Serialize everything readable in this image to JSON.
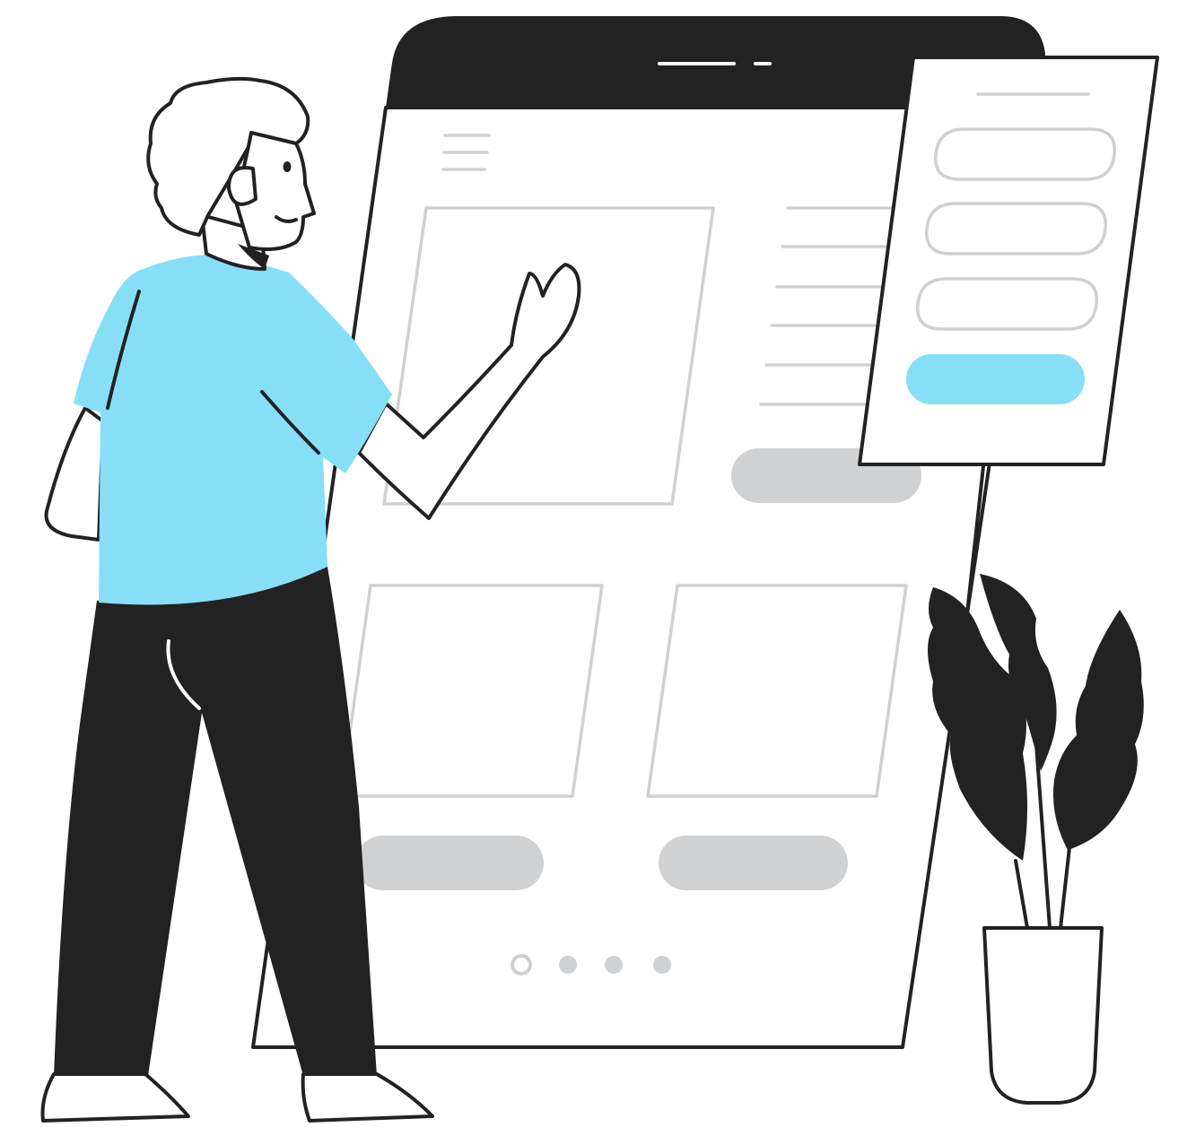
{
  "colors": {
    "ink": "#222222",
    "accent": "#87dff7",
    "placeholder": "#d0d1d3",
    "wireframe_line": "#d0d0d0",
    "paper": "#ffffff"
  },
  "illustration": {
    "subject": "person-pointing-at-tablet-wireframe",
    "icons": [
      "tablet-device",
      "login-form-panel",
      "potted-plant",
      "person"
    ]
  },
  "tablet": {
    "grid_cards": 3,
    "pagination": {
      "pages": 4,
      "active_index": 0
    }
  },
  "form_panel": {
    "input_fields": 3,
    "submit_button_color": "#87dff7"
  }
}
